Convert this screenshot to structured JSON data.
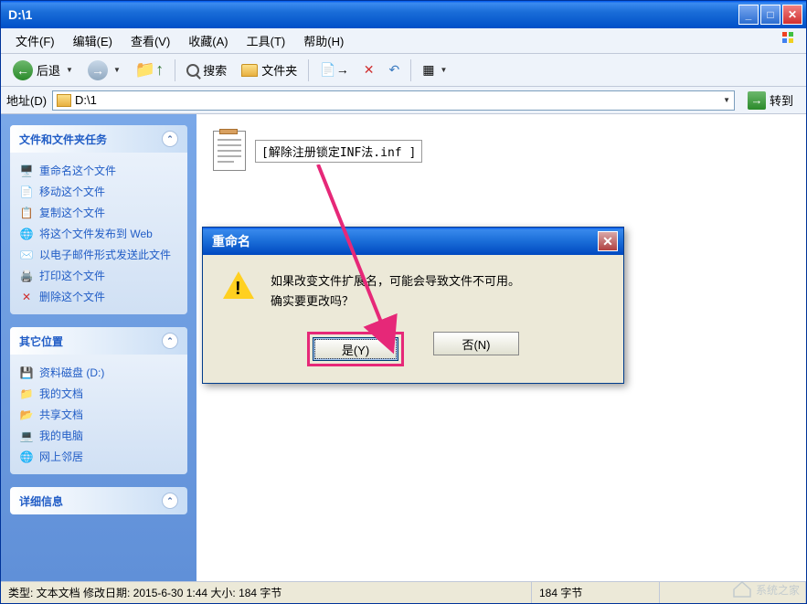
{
  "window": {
    "title": "D:\\1"
  },
  "menu": {
    "file": "文件(F)",
    "edit": "编辑(E)",
    "view": "查看(V)",
    "favorites": "收藏(A)",
    "tools": "工具(T)",
    "help": "帮助(H)"
  },
  "toolbar": {
    "back": "后退",
    "search": "搜索",
    "folders": "文件夹"
  },
  "address": {
    "label": "地址(D)",
    "value": "D:\\1",
    "go": "转到"
  },
  "sidebar": {
    "tasks": {
      "title": "文件和文件夹任务",
      "items": [
        {
          "icon": "rename",
          "label": "重命名这个文件"
        },
        {
          "icon": "move",
          "label": "移动这个文件"
        },
        {
          "icon": "copy",
          "label": "复制这个文件"
        },
        {
          "icon": "publish",
          "label": "将这个文件发布到 Web"
        },
        {
          "icon": "email",
          "label": "以电子邮件形式发送此文件"
        },
        {
          "icon": "print",
          "label": "打印这个文件"
        },
        {
          "icon": "delete",
          "label": "删除这个文件"
        }
      ]
    },
    "places": {
      "title": "其它位置",
      "items": [
        {
          "icon": "drive",
          "label": "资料磁盘 (D:)"
        },
        {
          "icon": "docs",
          "label": "我的文档"
        },
        {
          "icon": "shared",
          "label": "共享文档"
        },
        {
          "icon": "computer",
          "label": "我的电脑"
        },
        {
          "icon": "network",
          "label": "网上邻居"
        }
      ]
    },
    "details": {
      "title": "详细信息"
    }
  },
  "file": {
    "name": "[解除注册锁定INF法.inf ]"
  },
  "dialog": {
    "title": "重命名",
    "line1": "如果改变文件扩展名，可能会导致文件不可用。",
    "line2": "确实要更改吗？",
    "yes": "是(Y)",
    "no": "否(N)"
  },
  "statusbar": {
    "left": "类型: 文本文档 修改日期: 2015-6-30 1:44 大小: 184 字节",
    "mid": "184 字节"
  },
  "watermark": "系统之家"
}
